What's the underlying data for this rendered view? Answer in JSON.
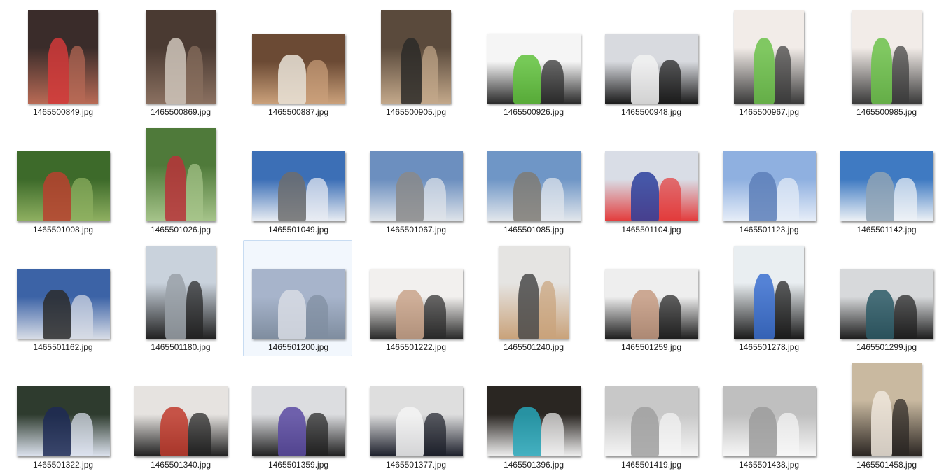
{
  "files": [
    {
      "name": "1465500849.jpg",
      "orientation": "portrait",
      "colors": [
        "#3a2c2a",
        "#b86a55",
        "#d23a3a"
      ]
    },
    {
      "name": "1465500869.jpg",
      "orientation": "portrait",
      "colors": [
        "#4a3a32",
        "#8a7060",
        "#cfc6bb"
      ]
    },
    {
      "name": "1465500887.jpg",
      "orientation": "landscape",
      "colors": [
        "#6b4a34",
        "#caa07a",
        "#e9e3d8"
      ]
    },
    {
      "name": "1465500905.jpg",
      "orientation": "portrait",
      "colors": [
        "#5a4a3c",
        "#c3a88a",
        "#2c2a28"
      ]
    },
    {
      "name": "1465500926.jpg",
      "orientation": "landscape",
      "colors": [
        "#f5f5f5",
        "#2a2a2a",
        "#5fc13b"
      ]
    },
    {
      "name": "1465500948.jpg",
      "orientation": "landscape",
      "colors": [
        "#d8dadf",
        "#1b1b1b",
        "#f2f2f2"
      ]
    },
    {
      "name": "1465500967.jpg",
      "orientation": "portrait",
      "colors": [
        "#f2ece8",
        "#3a3a3a",
        "#6cc24a"
      ]
    },
    {
      "name": "1465500985.jpg",
      "orientation": "portrait",
      "colors": [
        "#f2ece8",
        "#3a3a3a",
        "#6cc24a"
      ]
    },
    {
      "name": "1465501008.jpg",
      "orientation": "landscape",
      "colors": [
        "#3d6a2a",
        "#8fb061",
        "#b8412f"
      ]
    },
    {
      "name": "1465501026.jpg",
      "orientation": "portrait",
      "colors": [
        "#4f7a3a",
        "#a6c48a",
        "#b8333a"
      ]
    },
    {
      "name": "1465501049.jpg",
      "orientation": "landscape",
      "colors": [
        "#3c6fb6",
        "#e9edf3",
        "#6d6d6d"
      ]
    },
    {
      "name": "1465501067.jpg",
      "orientation": "landscape",
      "colors": [
        "#6c8fbf",
        "#dfe4ea",
        "#8a8a8a"
      ]
    },
    {
      "name": "1465501085.jpg",
      "orientation": "landscape",
      "colors": [
        "#6f96c6",
        "#e3e7ec",
        "#7f7b74"
      ]
    },
    {
      "name": "1465501104.jpg",
      "orientation": "landscape",
      "colors": [
        "#d9dde6",
        "#e33b3b",
        "#2b3f9c"
      ]
    },
    {
      "name": "1465501123.jpg",
      "orientation": "landscape",
      "colors": [
        "#8fb0e0",
        "#e7eef8",
        "#5d7fb8"
      ]
    },
    {
      "name": "1465501142.jpg",
      "orientation": "landscape",
      "colors": [
        "#3f7ac2",
        "#eef2f6",
        "#8fa3b5"
      ]
    },
    {
      "name": "1465501162.jpg",
      "orientation": "landscape",
      "colors": [
        "#3c63a6",
        "#d7dce6",
        "#2b2b2b"
      ]
    },
    {
      "name": "1465501180.jpg",
      "orientation": "portrait",
      "colors": [
        "#c9d2dc",
        "#222222",
        "#9aa1a8"
      ]
    },
    {
      "name": "1465501200.jpg",
      "orientation": "landscape",
      "colors": [
        "#a7b4cb",
        "#7f8d9f",
        "#d8dce4"
      ]
    },
    {
      "name": "1465501222.jpg",
      "orientation": "landscape",
      "colors": [
        "#f2f0ee",
        "#2a2a2a",
        "#c9a38a"
      ]
    },
    {
      "name": "1465501240.jpg",
      "orientation": "portrait",
      "colors": [
        "#e5e4e2",
        "#c9a27a",
        "#4a4a4a"
      ]
    },
    {
      "name": "1465501259.jpg",
      "orientation": "landscape",
      "colors": [
        "#eeeeee",
        "#1f1f1f",
        "#c59b82"
      ]
    },
    {
      "name": "1465501278.jpg",
      "orientation": "portrait",
      "colors": [
        "#e9eef1",
        "#1b1b1b",
        "#3a6fd0"
      ]
    },
    {
      "name": "1465501299.jpg",
      "orientation": "landscape",
      "colors": [
        "#d7d9db",
        "#1e1e1e",
        "#2d5b66"
      ]
    },
    {
      "name": "1465501322.jpg",
      "orientation": "landscape",
      "colors": [
        "#2e3b2e",
        "#dde3ef",
        "#1d2a55"
      ]
    },
    {
      "name": "1465501340.jpg",
      "orientation": "landscape",
      "colors": [
        "#e6e3e0",
        "#1f1f1f",
        "#c0392b"
      ]
    },
    {
      "name": "1465501359.jpg",
      "orientation": "landscape",
      "colors": [
        "#dcdde0",
        "#1f1f1f",
        "#5a4aa2"
      ]
    },
    {
      "name": "1465501377.jpg",
      "orientation": "landscape",
      "colors": [
        "#dedede",
        "#1c1f2a",
        "#f4f4f4"
      ]
    },
    {
      "name": "1465501396.jpg",
      "orientation": "landscape",
      "colors": [
        "#2a2622",
        "#f0f0f0",
        "#27a6b8"
      ]
    },
    {
      "name": "1465501419.jpg",
      "orientation": "landscape",
      "colors": [
        "#c8c8c8",
        "#f5f5f5",
        "#a0a0a0"
      ]
    },
    {
      "name": "1465501438.jpg",
      "orientation": "landscape",
      "colors": [
        "#bfbfbf",
        "#f7f7f7",
        "#9c9c9c"
      ]
    },
    {
      "name": "1465501458.jpg",
      "orientation": "portrait",
      "colors": [
        "#c9b9a0",
        "#2a2522",
        "#efe6dc"
      ]
    }
  ],
  "selected_index": 18
}
